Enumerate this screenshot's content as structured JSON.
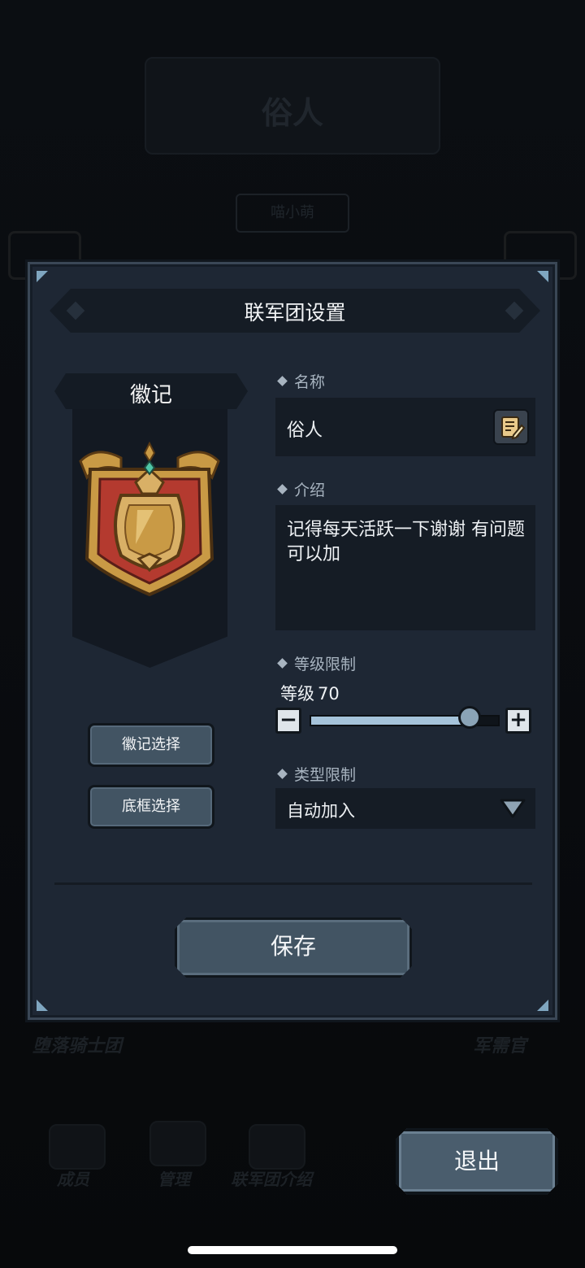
{
  "background": {
    "title": "俗人",
    "subtitle": "喵小萌",
    "left_label": "堕落骑士团",
    "right_label": "军需官",
    "tabs": [
      {
        "label": "成员",
        "icon": "members-icon"
      },
      {
        "label": "管理",
        "icon": "manage-icon"
      },
      {
        "label": "联军团介绍",
        "icon": "intro-scroll-icon"
      }
    ]
  },
  "dialog": {
    "title": "联军团设置",
    "emblem": {
      "header": "徽记",
      "select_emblem": "徽记选择",
      "select_frame": "底框选择"
    },
    "name": {
      "label": "名称",
      "value": "俗人"
    },
    "intro": {
      "label": "介绍",
      "value": "记得每天活跃一下谢谢 有问题可以加"
    },
    "level": {
      "label": "等级限制",
      "prefix": "等级",
      "value": "70",
      "slider_fraction": 0.84
    },
    "type": {
      "label": "类型限制",
      "value": "自动加入"
    },
    "save": "保存"
  },
  "exit": "退出",
  "colors": {
    "panel": "#1e2734",
    "input_bg": "#151c25",
    "button": "#425463",
    "emblem_red": "#b43a2f",
    "emblem_gold": "#c99a45"
  }
}
